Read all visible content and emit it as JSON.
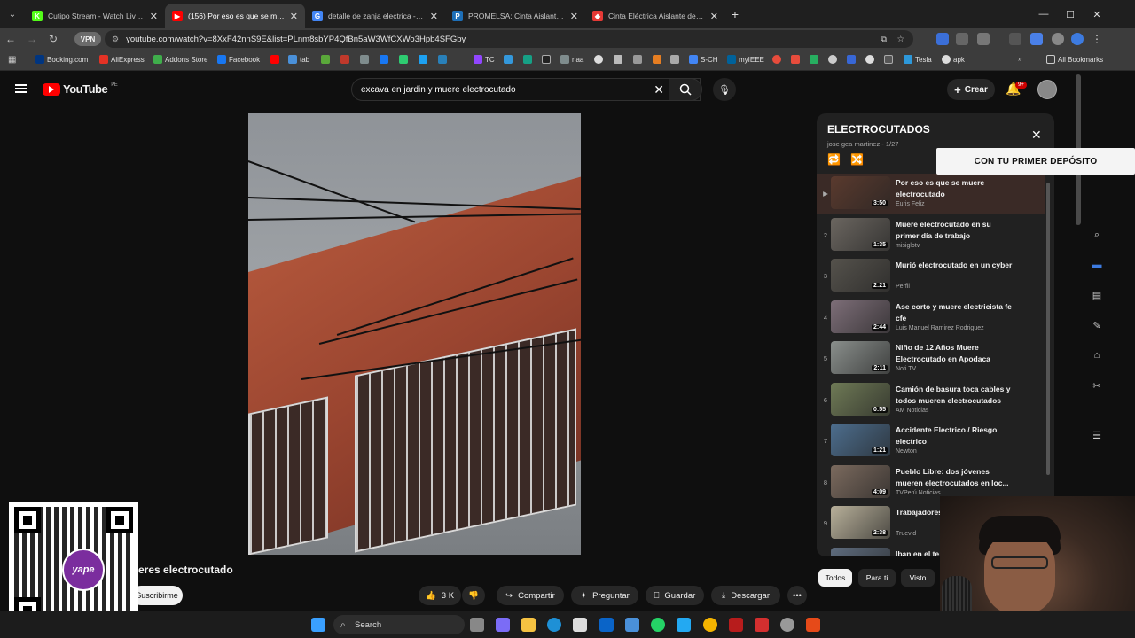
{
  "browser": {
    "tabs": [
      {
        "title": "Cutipo Stream - Watch Live on",
        "color": "#53fc18",
        "glyph": "K"
      },
      {
        "title": "(156) Por eso es que se muere",
        "color": "#ff0000",
        "glyph": "▶",
        "active": true
      },
      {
        "title": "detalle de zanja electrica - Busc",
        "color": "#4285f4",
        "glyph": "G"
      },
      {
        "title": "PROMELSA: Cinta Aislante Auto",
        "color": "#1d6fb8",
        "glyph": "P"
      },
      {
        "title": "Cinta Eléctrica Aislante de PVC",
        "color": "#e53935",
        "glyph": "◆"
      }
    ],
    "url": "youtube.com/watch?v=8XxF42nnS9E&list=PLnm8sbYP4QfBn5aW3WfCXWo3Hpb4SFGby",
    "vpn_label": "VPN",
    "bookmarks": [
      "Booking.com",
      "AliExpress",
      "Addons Store",
      "Facebook",
      "tab",
      "TC",
      "naa",
      "S-CH",
      "myIEEE",
      "Tesla",
      "apk"
    ],
    "all_bookmarks": "All Bookmarks"
  },
  "youtube": {
    "logo": "YouTube",
    "region": "PE",
    "search_query": "excava  en jardin y muere electrocutado",
    "create_label": "Crear",
    "notif_count": "9+",
    "video_title_fragment": "eres electrocutado",
    "subscribe_label": "Suscribirme",
    "actions": {
      "likes": "3 K",
      "share": "Compartir",
      "ask": "Preguntar",
      "save": "Guardar",
      "download": "Descargar"
    },
    "chips": [
      "Todos",
      "Para ti",
      "Visto"
    ]
  },
  "playlist": {
    "title": "ELECTROCUTADOS",
    "owner_pos": "jose gea martinez - 1/27",
    "promo": "CON TU PRIMER DEPÓSITO",
    "items": [
      {
        "num": "▶",
        "title": "Por eso es que se muere electrocutado",
        "channel": "Euris Feliz",
        "duration": "3:50",
        "thumb": "#5a3a2e"
      },
      {
        "num": "2",
        "title": "Muere electrocutado en su primer día de trabajo",
        "channel": "misiglotv",
        "duration": "1:35",
        "thumb": "#6b6660"
      },
      {
        "num": "3",
        "title": "Murió electrocutado en un cyber",
        "channel": "Perfil",
        "duration": "2:21",
        "thumb": "#55524c"
      },
      {
        "num": "4",
        "title": "Ase corto y muere electricista fe cfe",
        "channel": "Luis Manuel Ramirez Rodriguez",
        "duration": "2:44",
        "thumb": "#7d6e78"
      },
      {
        "num": "5",
        "title": "Niño de 12 Años Muere Electrocutado en Apodaca",
        "channel": "Noti TV",
        "duration": "2:11",
        "thumb": "#8a8f8c"
      },
      {
        "num": "6",
        "title": "Camión de basura toca cables y todos mueren electrocutados",
        "channel": "AM Noticias",
        "duration": "0:55",
        "thumb": "#6f7a56"
      },
      {
        "num": "7",
        "title": "Accidente Electrico / Riesgo electrico",
        "channel": "Newton",
        "duration": "1:21",
        "thumb": "#4d6e8e"
      },
      {
        "num": "8",
        "title": "Pueblo Libre: dos jóvenes mueren electrocutados en loc...",
        "channel": "TVPerú Noticias",
        "duration": "4:09",
        "thumb": "#7b6a5e"
      },
      {
        "num": "9",
        "title": "Trabajadores electrocutados",
        "channel": "Truevid",
        "duration": "2:38",
        "thumb": "#b8b09a"
      },
      {
        "num": "",
        "title": "Iban en el te",
        "channel": "",
        "duration": "",
        "thumb": "#5e6c7e"
      }
    ]
  },
  "taskbar": {
    "search_label": "Search"
  },
  "qr": {
    "brand": "yape"
  }
}
